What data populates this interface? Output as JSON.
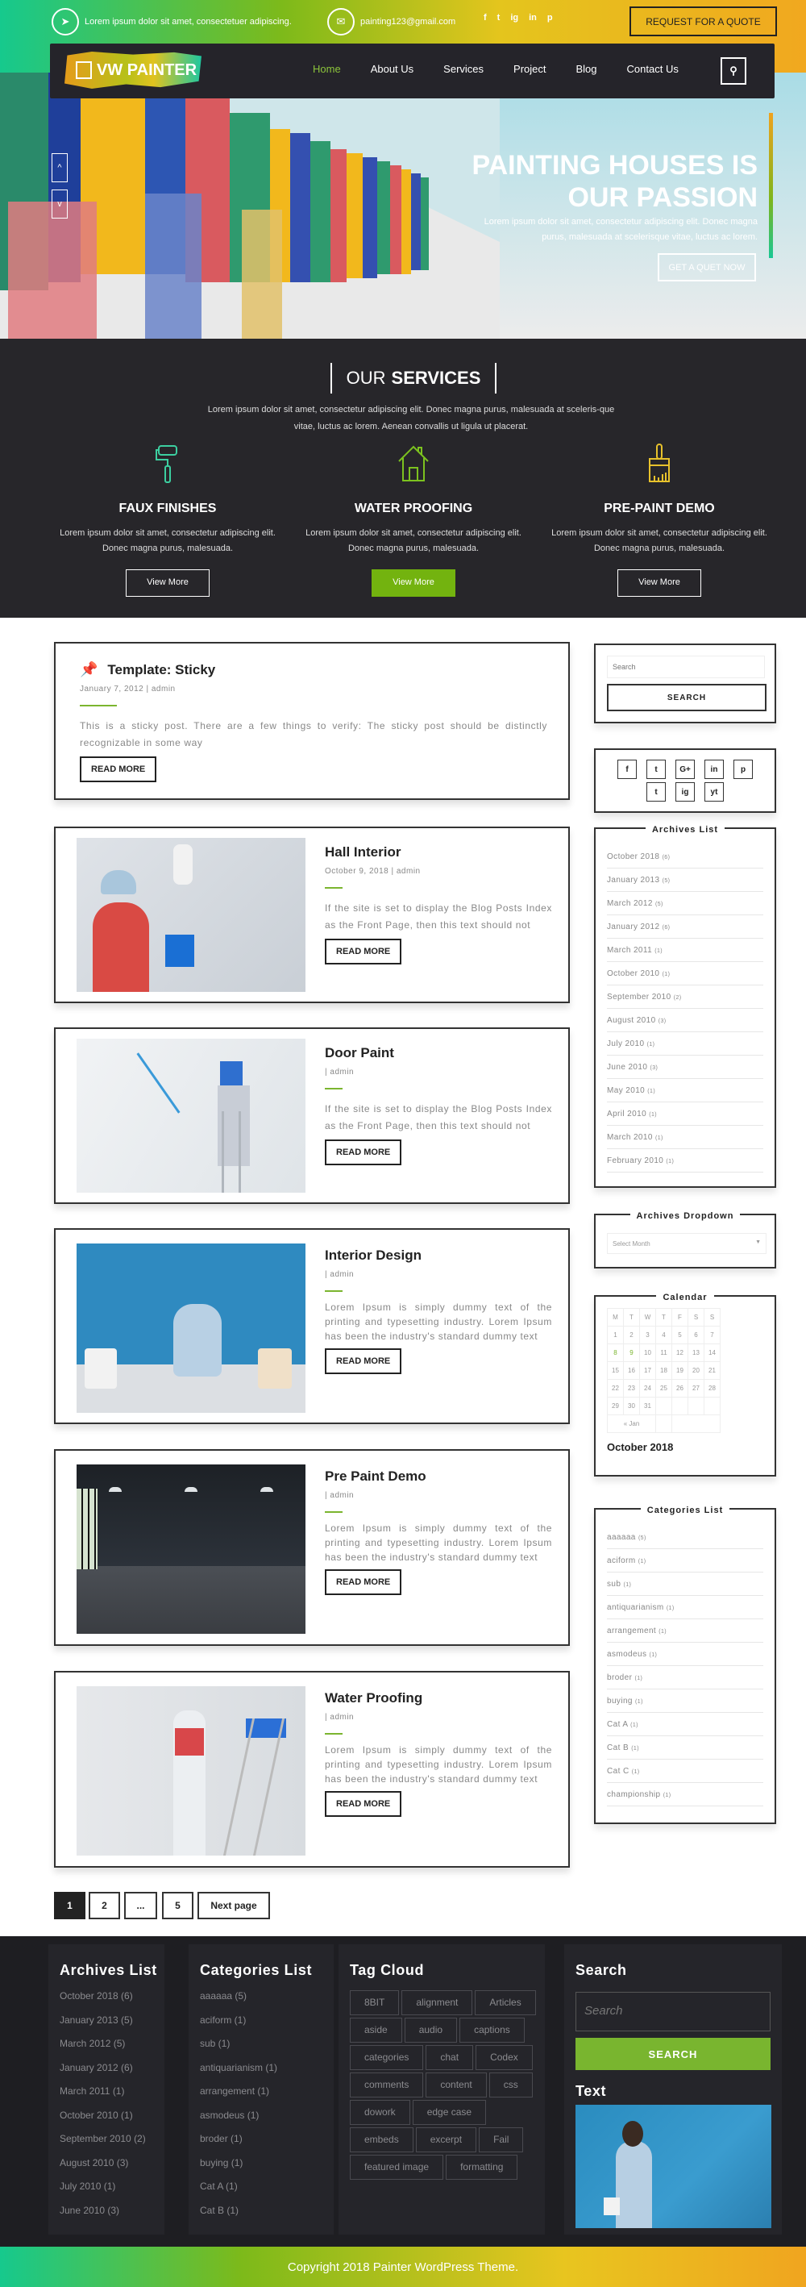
{
  "topbar": {
    "address": "Lorem ipsum dolor sit amet, consectetuer adipiscing.",
    "address_icon": "location-arrow-icon",
    "email": "painting123@gmail.com",
    "email_icon": "envelope-icon",
    "socials": [
      "f",
      "t",
      "ig",
      "in",
      "p"
    ],
    "quote_button": "REQUEST FOR A QUOTE"
  },
  "nav": {
    "logo": "VW PAINTER",
    "menu": [
      "Home",
      "About Us",
      "Services",
      "Project",
      "Blog",
      "Contact Us"
    ],
    "active": "Home",
    "search_icon": "⚲"
  },
  "hero": {
    "title_line1": "PAINTING HOUSES IS",
    "title_line2": "OUR PASSION",
    "description": "Lorem ipsum dolor sit amet, consectetur adipiscing elit. Donec magna purus, malesuada at scelerisque vitae, luctus ac lorem.",
    "button": "GET A QUET NOW",
    "arrow_up": "^",
    "arrow_down": "v"
  },
  "services": {
    "heading_light": "OUR",
    "heading_bold": "SERVICES",
    "description": "Lorem ipsum dolor sit amet, consectetur adipiscing elit. Donec magna purus, malesuada at sceleris-que vitae, luctus ac lorem. Aenean convallis ut ligula ut placerat.",
    "items": [
      {
        "title": "FAUX FINISHES",
        "text": "Lorem ipsum dolor sit amet, consectetur adipiscing elit. Donec magna purus, malesuada.",
        "button": "View More",
        "icon": "paint-roller-icon",
        "color": "#3ccfa0"
      },
      {
        "title": "WATER PROOFING",
        "text": "Lorem ipsum dolor sit amet, consectetur adipiscing elit. Donec magna purus, malesuada.",
        "button": "View More",
        "icon": "house-icon",
        "color": "#7cc21f"
      },
      {
        "title": "PRE-PAINT DEMO",
        "text": "Lorem ipsum dolor sit amet, consectetur adipiscing elit. Donec magna purus, malesuada.",
        "button": "View More",
        "icon": "paint-brush-icon",
        "color": "#e8c22c"
      }
    ]
  },
  "posts": [
    {
      "title": "Template: Sticky",
      "meta": "January 7, 2012  |   admin",
      "excerpt": "This is a sticky post. There are a few things to verify: The sticky post should be distinctly recognizable in some way",
      "button": "READ MORE"
    },
    {
      "title": "Hall Interior",
      "meta": "October 9, 2018 |  admin",
      "excerpt": "If the site is set to display the Blog Posts Index as the Front Page, then this text should not",
      "button": "READ MORE"
    },
    {
      "title": "Door Paint",
      "meta": "| admin",
      "excerpt": "If the site is set to display the Blog Posts Index as the Front Page, then this text should not",
      "button": "READ MORE"
    },
    {
      "title": "Interior Design",
      "meta": "| admin",
      "excerpt": "Lorem Ipsum is simply dummy text of the printing and typesetting industry. Lorem Ipsum has been the industry's standard dummy text",
      "button": "READ MORE"
    },
    {
      "title": "Pre Paint Demo",
      "meta": "| admin",
      "excerpt": "Lorem Ipsum is simply dummy text of the printing and typesetting industry. Lorem Ipsum has been the industry's standard dummy text",
      "button": "READ MORE"
    },
    {
      "title": "Water Proofing",
      "meta": "| admin",
      "excerpt": "Lorem Ipsum is simply dummy text of the printing and typesetting industry. Lorem Ipsum has been the industry's standard dummy text",
      "button": "READ MORE"
    }
  ],
  "pagination": [
    "1",
    "2",
    "...",
    "5",
    "Next page"
  ],
  "sidebar": {
    "search_placeholder": "Search",
    "search_button": "SEARCH",
    "socials": [
      "f",
      "t",
      "G+",
      "in",
      "p",
      "t",
      "ig",
      "yt"
    ],
    "archives_title": "Archives List",
    "archives": [
      {
        "label": "October 2018",
        "count": "(6)"
      },
      {
        "label": "January 2013",
        "count": "(5)"
      },
      {
        "label": "March 2012",
        "count": "(5)"
      },
      {
        "label": "January 2012",
        "count": "(6)"
      },
      {
        "label": "March 2011",
        "count": "(1)"
      },
      {
        "label": "October 2010",
        "count": "(1)"
      },
      {
        "label": "September 2010",
        "count": "(2)"
      },
      {
        "label": "August 2010",
        "count": "(3)"
      },
      {
        "label": "July 2010",
        "count": "(1)"
      },
      {
        "label": "June 2010",
        "count": "(3)"
      },
      {
        "label": "May 2010",
        "count": "(1)"
      },
      {
        "label": "April 2010",
        "count": "(1)"
      },
      {
        "label": "March 2010",
        "count": "(1)"
      },
      {
        "label": "February 2010",
        "count": "(1)"
      }
    ],
    "dropdown_title": "Archives Dropdown",
    "dropdown_value": "Select Month",
    "calendar_title": "Calendar",
    "calendar_days": [
      "M",
      "T",
      "W",
      "T",
      "F",
      "S",
      "S"
    ],
    "calendar_weeks": [
      [
        "1",
        "2",
        "3",
        "4",
        "5",
        "6",
        "7"
      ],
      [
        "8",
        "9",
        "10",
        "11",
        "12",
        "13",
        "14"
      ],
      [
        "15",
        "16",
        "17",
        "18",
        "19",
        "20",
        "21"
      ],
      [
        "22",
        "23",
        "24",
        "25",
        "26",
        "27",
        "28"
      ],
      [
        "29",
        "30",
        "31",
        "",
        "",
        "",
        ""
      ]
    ],
    "calendar_linked": [
      "8",
      "9"
    ],
    "calendar_prev": "« Jan",
    "calendar_caption": "October 2018",
    "categories_title": "Categories List",
    "categories": [
      {
        "label": "aaaaaa",
        "count": "(5)"
      },
      {
        "label": "aciform",
        "count": "(1)"
      },
      {
        "label": "sub",
        "count": "(1)"
      },
      {
        "label": "antiquarianism",
        "count": "(1)"
      },
      {
        "label": "arrangement",
        "count": "(1)"
      },
      {
        "label": "asmodeus",
        "count": "(1)"
      },
      {
        "label": "broder",
        "count": "(1)"
      },
      {
        "label": "buying",
        "count": "(1)"
      },
      {
        "label": "Cat A",
        "count": "(1)"
      },
      {
        "label": "Cat B",
        "count": "(1)"
      },
      {
        "label": "Cat C",
        "count": "(1)"
      },
      {
        "label": "championship",
        "count": "(1)"
      }
    ]
  },
  "footer": {
    "archives_title": "Archives List",
    "archives": [
      "October 2018 (6)",
      "January 2013 (5)",
      "March 2012 (5)",
      "January 2012 (6)",
      "March 2011 (1)",
      "October 2010 (1)",
      "September 2010 (2)",
      "August 2010 (3)",
      "July 2010 (1)",
      "June 2010 (3)"
    ],
    "categories_title": "Categories List",
    "categories": [
      "aaaaaa (5)",
      "aciform (1)",
      "sub (1)",
      "antiquarianism (1)",
      "arrangement (1)",
      "asmodeus (1)",
      "broder (1)",
      "buying (1)",
      "Cat A (1)",
      "Cat B (1)"
    ],
    "tags_title": "Tag Cloud",
    "tags": [
      "8BIT",
      "alignment",
      "Articles",
      "aside",
      "audio",
      "captions",
      "categories",
      "chat",
      "Codex",
      "comments",
      "content",
      "css",
      "dowork",
      "edge case",
      "embeds",
      "excerpt",
      "Fail",
      "featured image",
      "formatting"
    ],
    "search_title": "Search",
    "search_placeholder": "Search",
    "search_button": "SEARCH",
    "text_title": "Text"
  },
  "copyright": "Copyright 2018 Painter WordPress Theme.",
  "colors": {
    "accent_green": "#79b52f",
    "dark": "#25242a",
    "gold": "#f1a81f",
    "teal": "#16c98d"
  }
}
